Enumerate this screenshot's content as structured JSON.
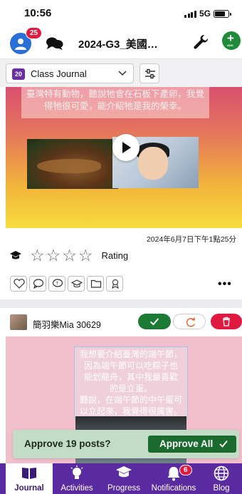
{
  "status_bar": {
    "time": "10:56",
    "network": "5G"
  },
  "topnav": {
    "avatar_badge": "25",
    "class_title": "2024-G3_美國…",
    "add_label": "ADD"
  },
  "selector": {
    "journal_number": "20",
    "journal_name": "Class Journal"
  },
  "post1": {
    "caption": "臺灣特有動物，聽說牠會在石板下產卵，我覺得牠很可愛，能介紹牠是我的榮幸。",
    "date": "2024年6月7日下午1點25分",
    "rating_label": "Rating",
    "rating_stars": 4,
    "rating_value": 0
  },
  "post2": {
    "author": "簡羽樂Mia 30629",
    "caption_lines": [
      "我想要介紹臺灣的端午節，",
      "因為端午節可以吃粽子也",
      "能划龍舟，其中我最喜歡",
      "的是立蛋。",
      "聽說，在端午節的中午蛋可",
      "以立起來，我覺得很厲害。"
    ]
  },
  "approve_banner": {
    "text": "Approve 19 posts?",
    "button_label": "Approve All"
  },
  "tabbar": {
    "tabs": [
      {
        "label": "Journal"
      },
      {
        "label": "Activities"
      },
      {
        "label": "Progress"
      },
      {
        "label": "Notifications"
      },
      {
        "label": "Blog"
      }
    ],
    "notifications_badge": "6"
  },
  "colors": {
    "brand_purple": "#5a2aa0",
    "approve_green": "#1b7b35",
    "delete_red": "#e0193f",
    "banner_green": "#c3dcc6"
  }
}
